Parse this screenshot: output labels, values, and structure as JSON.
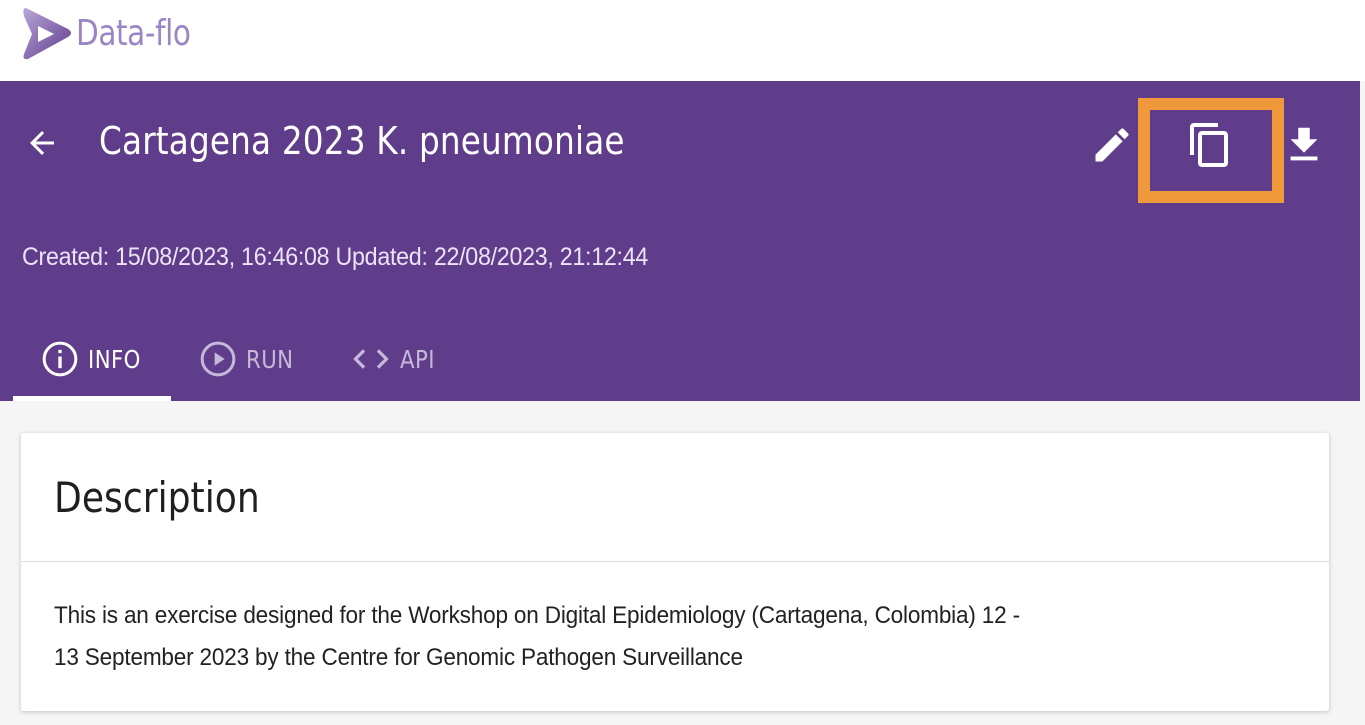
{
  "app": {
    "logo_text": "Data-flo"
  },
  "header": {
    "title": "Cartagena 2023 K. pneumoniae",
    "timestamps": "Created: 15/08/2023, 16:46:08 Updated: 22/08/2023, 21:12:44",
    "actions": [
      {
        "name": "edit",
        "icon": "pencil-icon"
      },
      {
        "name": "duplicate",
        "icon": "copy-icon"
      },
      {
        "name": "download",
        "icon": "download-icon"
      }
    ],
    "highlight_color": "#f0993a",
    "background_color": "#5f3d8a"
  },
  "tabs": [
    {
      "label": "INFO",
      "icon": "info-circle-icon",
      "active": true
    },
    {
      "label": "RUN",
      "icon": "play-circle-icon",
      "active": false
    },
    {
      "label": "API",
      "icon": "code-icon",
      "active": false
    }
  ],
  "description": {
    "title": "Description",
    "line1": "This is an exercise designed for the Workshop on Digital Epidemiology (Cartagena, Colombia) 12 -",
    "line2": "13 September 2023 by the Centre for Genomic Pathogen Surveillance"
  }
}
